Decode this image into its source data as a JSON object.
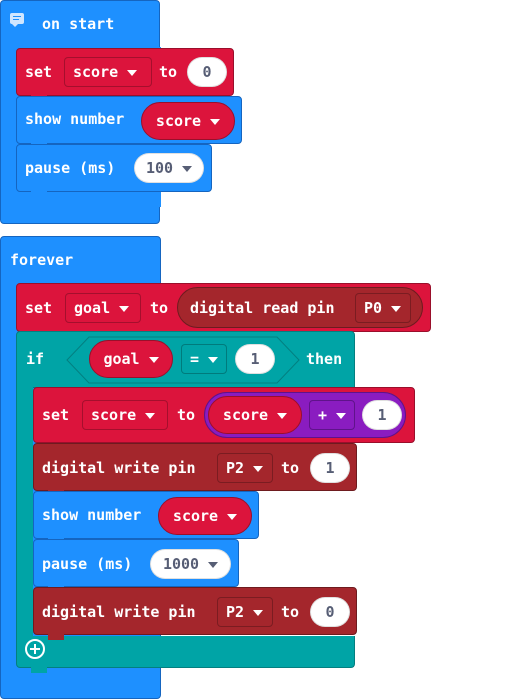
{
  "on_start": {
    "hat_label": "on start",
    "set_block": {
      "label": "set",
      "variable": "score",
      "to_label": "to",
      "value": "0"
    },
    "show_number": {
      "label": "show number",
      "variable": "score"
    },
    "pause": {
      "label": "pause (ms)",
      "value": "100"
    }
  },
  "forever": {
    "hat_label": "forever",
    "set_goal": {
      "label": "set",
      "variable": "goal",
      "to_label": "to",
      "read_label": "digital read pin",
      "pin": "P0"
    },
    "if_block": {
      "if_label": "if",
      "then_label": "then",
      "left": "goal",
      "operator": "=",
      "right": "1",
      "set_score": {
        "label": "set",
        "variable": "score",
        "to_label": "to",
        "operand": "score",
        "operator": "+",
        "value": "1"
      },
      "write_high": {
        "label": "digital write pin",
        "pin": "P2",
        "to_label": "to",
        "value": "1"
      },
      "show_number": {
        "label": "show number",
        "variable": "score"
      },
      "pause": {
        "label": "pause (ms)",
        "value": "1000"
      },
      "write_low": {
        "label": "digital write pin",
        "pin": "P2",
        "to_label": "to",
        "value": "0"
      }
    }
  },
  "colors": {
    "basic": "#1e90ff",
    "variables": "#dc143c",
    "pins": "#a4262c",
    "logic": "#00a4a6",
    "math": "#8a1cc0"
  }
}
